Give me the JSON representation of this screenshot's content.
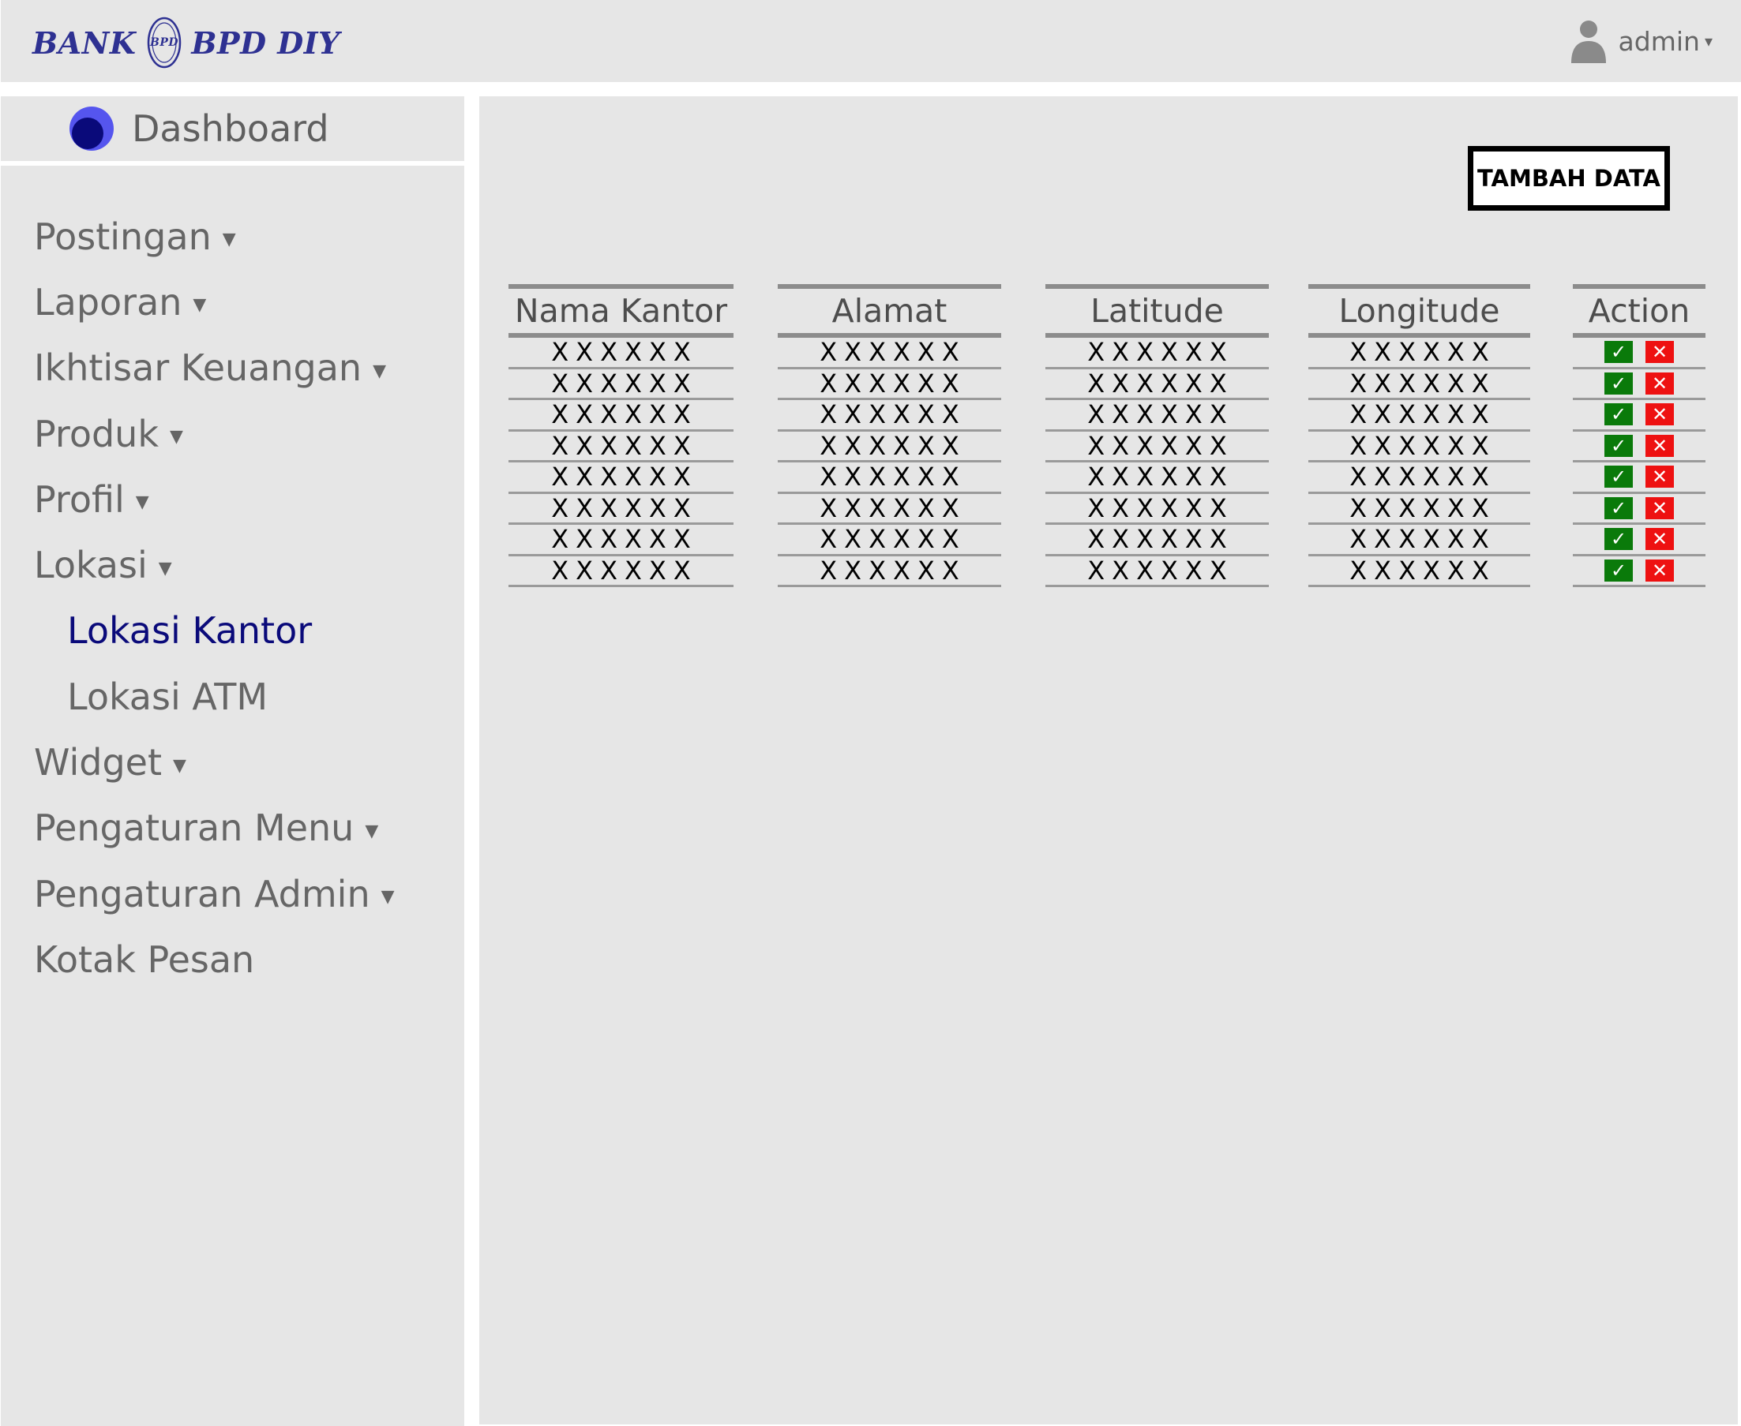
{
  "header": {
    "brand_left": "BANK",
    "brand_right": "BPD DIY",
    "user_name": "admin",
    "user_caret": "▾",
    "brand_color": "#2e3192"
  },
  "sidebar": {
    "dashboard_label": "Dashboard",
    "items": [
      {
        "label": "Postingan",
        "has_caret": true
      },
      {
        "label": "Laporan",
        "has_caret": true
      },
      {
        "label": "Ikhtisar Keuangan",
        "has_caret": true
      },
      {
        "label": "Produk",
        "has_caret": true
      },
      {
        "label": "Profil",
        "has_caret": true
      },
      {
        "label": "Lokasi",
        "has_caret": true
      },
      {
        "label": "Lokasi Kantor",
        "sub": true,
        "active": true
      },
      {
        "label": "Lokasi ATM",
        "sub": true
      },
      {
        "label": "Widget",
        "has_caret": true
      },
      {
        "label": "Pengaturan Menu",
        "has_caret": true
      },
      {
        "label": "Pengaturan Admin",
        "has_caret": true
      },
      {
        "label": "Kotak Pesan"
      }
    ],
    "caret": "▼",
    "active_color": "#0a0a7a"
  },
  "main": {
    "add_button_label": "TAMBAH DATA",
    "table": {
      "headers": [
        "Nama Kantor",
        "Alamat",
        "Latitude",
        "Longitude",
        "Action"
      ],
      "rows": [
        [
          "XXXXXX",
          "XXXXXX",
          "XXXXXX",
          "XXXXXX"
        ],
        [
          "XXXXXX",
          "XXXXXX",
          "XXXXXX",
          "XXXXXX"
        ],
        [
          "XXXXXX",
          "XXXXXX",
          "XXXXXX",
          "XXXXXX"
        ],
        [
          "XXXXXX",
          "XXXXXX",
          "XXXXXX",
          "XXXXXX"
        ],
        [
          "XXXXXX",
          "XXXXXX",
          "XXXXXX",
          "XXXXXX"
        ],
        [
          "XXXXXX",
          "XXXXXX",
          "XXXXXX",
          "XXXXXX"
        ],
        [
          "XXXXXX",
          "XXXXXX",
          "XXXXXX",
          "XXXXXX"
        ],
        [
          "XXXXXX",
          "XXXXXX",
          "XXXXXX",
          "XXXXXX"
        ]
      ],
      "edit_glyph": "✓",
      "delete_glyph": "✕",
      "edit_color": "#0a7a0a",
      "delete_color": "#ee1111"
    }
  }
}
